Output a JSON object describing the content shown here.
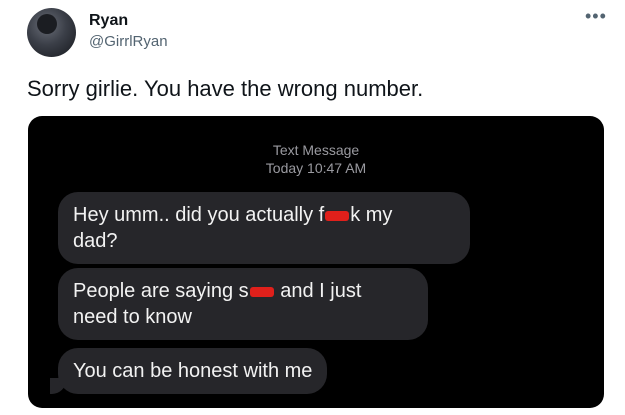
{
  "tweet": {
    "author_name": "Ryan",
    "author_handle": "@GirrlRyan",
    "more_icon": "more-options-icon",
    "text": "Sorry girlie. You have the wrong number."
  },
  "screenshot": {
    "header_line1": "Text Message",
    "header_line2": "Today 10:47 AM",
    "messages": [
      {
        "before": "Hey umm.. did you actually f",
        "after": "k my",
        "line2": "dad?"
      },
      {
        "before": "People are saying s",
        "after": " and I just",
        "line2": "need to know"
      },
      {
        "text": "You can be honest with me"
      }
    ],
    "colors": {
      "bubble": "#26262a",
      "redaction": "#e0201b"
    }
  }
}
